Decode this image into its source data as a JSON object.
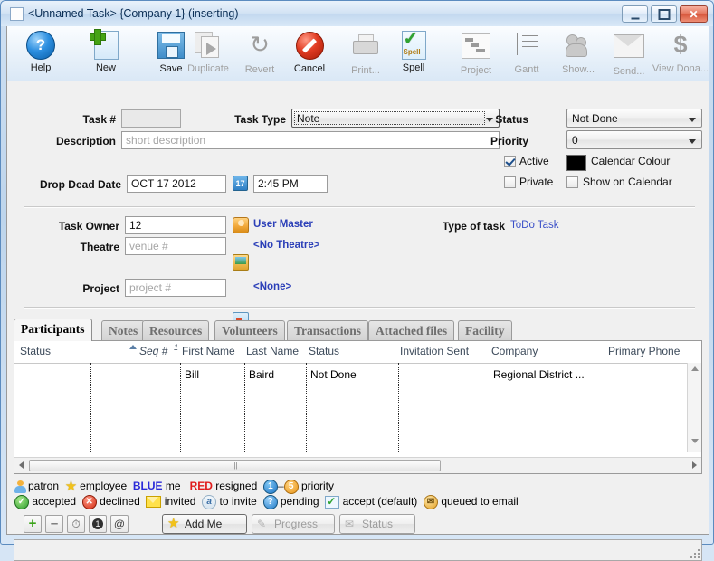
{
  "window": {
    "title": "<Unnamed Task> {Company 1} (inserting)",
    "minimize_label": "–",
    "maximize_label": "□",
    "close_label": "✕"
  },
  "toolbar": {
    "items": [
      {
        "label": "Help",
        "icon": "help-icon",
        "enabled": true
      },
      {
        "label": "New",
        "icon": "new-page-icon",
        "enabled": true
      },
      {
        "label": "Save",
        "icon": "save-disk-icon",
        "enabled": true
      },
      {
        "label": "Duplicate",
        "icon": "duplicate-icon",
        "enabled": false
      },
      {
        "label": "Revert",
        "icon": "revert-arrows-icon",
        "enabled": false
      },
      {
        "label": "Cancel",
        "icon": "cancel-icon",
        "enabled": true
      },
      {
        "label": "Print...",
        "icon": "printer-icon",
        "enabled": false
      },
      {
        "label": "Spell",
        "icon": "spell-check-icon",
        "enabled": true
      },
      {
        "label": "Project",
        "icon": "project-icon",
        "enabled": false
      },
      {
        "label": "Gantt",
        "icon": "gantt-icon",
        "enabled": false
      },
      {
        "label": "Show...",
        "icon": "show-people-icon",
        "enabled": false
      },
      {
        "label": "Send...",
        "icon": "send-envelope-icon",
        "enabled": false
      },
      {
        "label": "View Dona...",
        "icon": "dollar-icon",
        "enabled": false
      }
    ]
  },
  "form": {
    "task_number_label": "Task #",
    "task_number_value": "",
    "task_type_label": "Task Type",
    "task_type_value": "Note",
    "description_label": "Description",
    "description_placeholder": "short description",
    "description_value": "",
    "drop_dead_date_label": "Drop Dead Date",
    "drop_dead_date_value": "OCT 17 2012",
    "drop_dead_time_value": "2:45 PM",
    "calendar_button_icon": "calendar-picker-icon",
    "status_label": "Status",
    "status_value": "Not Done",
    "priority_label": "Priority",
    "priority_value": "0",
    "active_label": "Active",
    "active_checked": true,
    "private_label": "Private",
    "private_checked": false,
    "calendar_colour_label": "Calendar Colour",
    "calendar_colour_value": "#000000",
    "show_on_calendar_label": "Show on Calendar",
    "show_on_calendar_checked": false,
    "task_owner_label": "Task Owner",
    "task_owner_value": "12",
    "task_owner_link": "User Master",
    "task_owner_icon": "user-icon",
    "theatre_label": "Theatre",
    "theatre_placeholder": "venue #",
    "theatre_value": "",
    "theatre_link": "<No Theatre>",
    "theatre_icon": "venue-icon",
    "project_label": "Project",
    "project_placeholder": "project #",
    "project_value": "",
    "project_link": "<None>",
    "project_icon": "project-small-icon",
    "type_of_task_label": "Type of task",
    "type_of_task_value": "ToDo Task"
  },
  "tabs": [
    {
      "label": "Participants",
      "active": true
    },
    {
      "label": "Notes",
      "active": false
    },
    {
      "label": "Resources",
      "active": false
    },
    {
      "label": "Volunteers",
      "active": false
    },
    {
      "label": "Transactions",
      "active": false
    },
    {
      "label": "Attached files",
      "active": false
    },
    {
      "label": "Facility",
      "active": false
    }
  ],
  "grid": {
    "columns": [
      {
        "label": "Status",
        "italic": false
      },
      {
        "label": "",
        "italic": false
      },
      {
        "label": "Seq #",
        "italic": true,
        "sort": "asc"
      },
      {
        "label": "First Name",
        "italic": false
      },
      {
        "label": "Last Name",
        "italic": false
      },
      {
        "label": "Status",
        "italic": false
      },
      {
        "label": "Invitation Sent",
        "italic": false
      },
      {
        "label": "Company",
        "italic": false
      },
      {
        "label": "Primary Phone",
        "italic": false
      }
    ],
    "rows": [
      {
        "status_icon": "",
        "blank": "",
        "seq": "",
        "first_name": "Bill",
        "last_name": "Baird",
        "status": "Not Done",
        "invitation_sent": "",
        "company": "Regional District ...",
        "primary_phone": ""
      }
    ]
  },
  "legend": {
    "row1": [
      {
        "icon": "patron-icon",
        "text": "patron"
      },
      {
        "icon": "star-icon",
        "text": "employee"
      },
      {
        "icon": "blue-keyword",
        "text": "me",
        "keyword": "BLUE"
      },
      {
        "icon": "red-keyword",
        "text": "resigned",
        "keyword": "RED"
      },
      {
        "icon": "number-badges",
        "text": "priority",
        "from": "1",
        "to": "5"
      }
    ],
    "row2": [
      {
        "icon": "accepted-icon",
        "text": "accepted"
      },
      {
        "icon": "declined-icon",
        "text": "declined"
      },
      {
        "icon": "invited-icon",
        "text": "invited"
      },
      {
        "icon": "to-invite-icon",
        "text": "to invite"
      },
      {
        "icon": "pending-icon",
        "text": "pending"
      },
      {
        "icon": "accept-default-icon",
        "text": "accept (default)"
      },
      {
        "icon": "queued-email-icon",
        "text": "queued to email"
      }
    ]
  },
  "actions": {
    "add_icon": "plus-icon",
    "remove_icon": "minus-icon",
    "clock_icon": "clock-icon",
    "one_icon": "one-badge-icon",
    "at_icon": "at-sign-icon",
    "add_me_label": "Add Me",
    "add_me_icon": "star-icon",
    "progress_label": "Progress",
    "progress_icon": "progress-icon",
    "progress_enabled": false,
    "status_label": "Status",
    "status_icon": "status-icon",
    "status_enabled": false
  },
  "statusbar": {
    "text": ""
  }
}
